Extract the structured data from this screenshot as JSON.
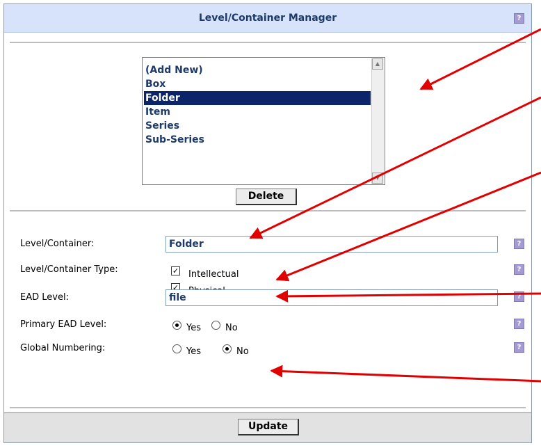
{
  "title": "Level/Container Manager",
  "help_icon_glyph": "?",
  "list": {
    "items": [
      "(Add New)",
      "Box",
      "Folder",
      "Item",
      "Series",
      "Sub-Series"
    ],
    "selected": "Folder",
    "scroll_up_glyph": "▲",
    "scroll_down_glyph": "▼"
  },
  "buttons": {
    "delete": "Delete",
    "update": "Update"
  },
  "form": {
    "level_container_label": "Level/Container:",
    "level_container_value": "Folder",
    "type_label": "Level/Container Type:",
    "type_options": [
      {
        "label": "Intellectual",
        "checked": true
      },
      {
        "label": "Physical",
        "checked": true
      }
    ],
    "ead_level_label": "EAD Level:",
    "ead_level_value": "file",
    "primary_ead_label": "Primary EAD Level:",
    "primary_ead_value": "Yes",
    "global_numbering_label": "Global Numbering:",
    "global_numbering_value": "No",
    "yes_label": "Yes",
    "no_label": "No",
    "check_glyph": "✓"
  },
  "colors": {
    "accent": "#1d3a6b",
    "titlebar": "#d6e3fa",
    "annotation_arrow": "#e00000"
  }
}
